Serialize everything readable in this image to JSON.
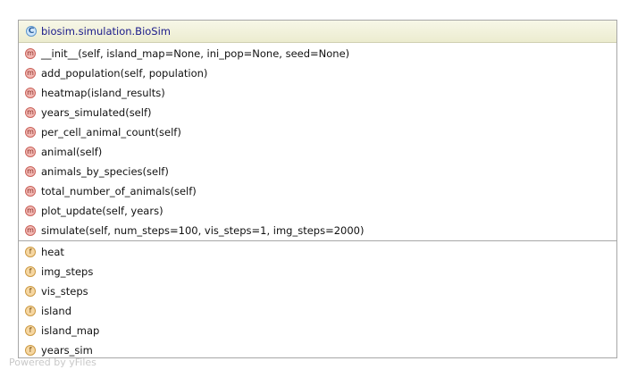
{
  "class": {
    "badge": "C",
    "name": "biosim.simulation.BioSim"
  },
  "methods": [
    {
      "badge": "m",
      "label": "__init__(self, island_map=None, ini_pop=None, seed=None)"
    },
    {
      "badge": "m",
      "label": "add_population(self, population)"
    },
    {
      "badge": "m",
      "label": "heatmap(island_results)"
    },
    {
      "badge": "m",
      "label": "years_simulated(self)"
    },
    {
      "badge": "m",
      "label": "per_cell_animal_count(self)"
    },
    {
      "badge": "m",
      "label": "animal(self)"
    },
    {
      "badge": "m",
      "label": "animals_by_species(self)"
    },
    {
      "badge": "m",
      "label": "total_number_of_animals(self)"
    },
    {
      "badge": "m",
      "label": "plot_update(self, years)"
    },
    {
      "badge": "m",
      "label": "simulate(self, num_steps=100,  vis_steps=1, img_steps=2000)"
    }
  ],
  "fields": [
    {
      "badge": "f",
      "label": "heat"
    },
    {
      "badge": "f",
      "label": "img_steps"
    },
    {
      "badge": "f",
      "label": "vis_steps"
    },
    {
      "badge": "f",
      "label": "island"
    },
    {
      "badge": "f",
      "label": "island_map"
    },
    {
      "badge": "f",
      "label": "years_sim"
    }
  ],
  "credit": "Powered by yFiles",
  "colors": {
    "header_bg": "#ececcf",
    "class_name": "#1a1a8a",
    "method_badge": "#f3b9b4",
    "field_badge": "#f6d7a2",
    "border": "#a7a7a7"
  }
}
